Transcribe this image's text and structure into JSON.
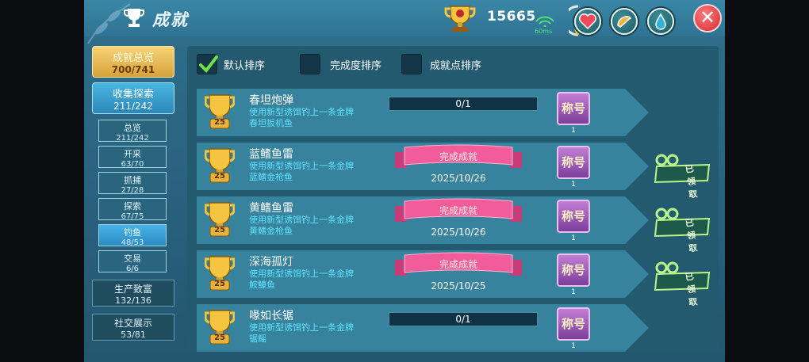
{
  "header": {
    "title": "成就",
    "score": "15665",
    "ping": "60ms",
    "close_label": "✕"
  },
  "sort": {
    "options": [
      {
        "label": "默认排序",
        "checked": true
      },
      {
        "label": "完成度排序",
        "checked": false
      },
      {
        "label": "成就点排序",
        "checked": false
      }
    ]
  },
  "sidebar": {
    "overview": {
      "label": "成就总览",
      "count": "700/741"
    },
    "collect": {
      "label": "收集探索",
      "count": "211/242"
    },
    "subs": [
      {
        "label": "总览",
        "count": "211/242"
      },
      {
        "label": "开采",
        "count": "63/70"
      },
      {
        "label": "抓捕",
        "count": "27/28"
      },
      {
        "label": "探索",
        "count": "67/75"
      },
      {
        "label": "钓鱼",
        "count": "48/53"
      },
      {
        "label": "交易",
        "count": "6/6"
      }
    ],
    "others": [
      {
        "label": "生产致富",
        "count": "132/136"
      },
      {
        "label": "社交展示",
        "count": "53/81"
      }
    ]
  },
  "achievements": [
    {
      "name": "春坦炮弹",
      "points": "25",
      "desc1": "使用新型诱饵钓上一条金牌",
      "desc2": "春坦扳机鱼",
      "status": "progress",
      "progress": "0/1",
      "badge": "称号",
      "badge_count": "1"
    },
    {
      "name": "蓝鳍鱼雷",
      "points": "25",
      "desc1": "使用新型诱饵钓上一条金牌",
      "desc2": "蓝鳍金枪鱼",
      "status": "done",
      "done_label": "完成成就",
      "date": "2025/10/26",
      "badge": "称号",
      "badge_count": "1",
      "claimed_label": "已领取"
    },
    {
      "name": "黄鳍鱼雷",
      "points": "25",
      "desc1": "使用新型诱饵钓上一条金牌",
      "desc2": "黄鳍金枪鱼",
      "status": "done",
      "done_label": "完成成就",
      "date": "2025/10/26",
      "badge": "称号",
      "badge_count": "1",
      "claimed_label": "已领取"
    },
    {
      "name": "深海孤灯",
      "points": "25",
      "desc1": "使用新型诱饵钓上一条金牌",
      "desc2": "鮟鱇鱼",
      "status": "done",
      "done_label": "完成成就",
      "date": "2025/10/25",
      "badge": "称号",
      "badge_count": "1",
      "claimed_label": "已领取"
    },
    {
      "name": "喙如长锯",
      "points": "25",
      "desc1": "使用新型诱饵钓上一条金牌",
      "desc2": "锯鳐",
      "status": "progress",
      "progress": "0/1",
      "badge": "称号",
      "badge_count": "1"
    }
  ],
  "colors": {
    "accent_gold": "#f7d377",
    "accent_blue": "#49b3e6",
    "ribbon_pink": "#f25c9a",
    "desc_cyan": "#5fe3ff",
    "close_red": "#d22a35"
  }
}
